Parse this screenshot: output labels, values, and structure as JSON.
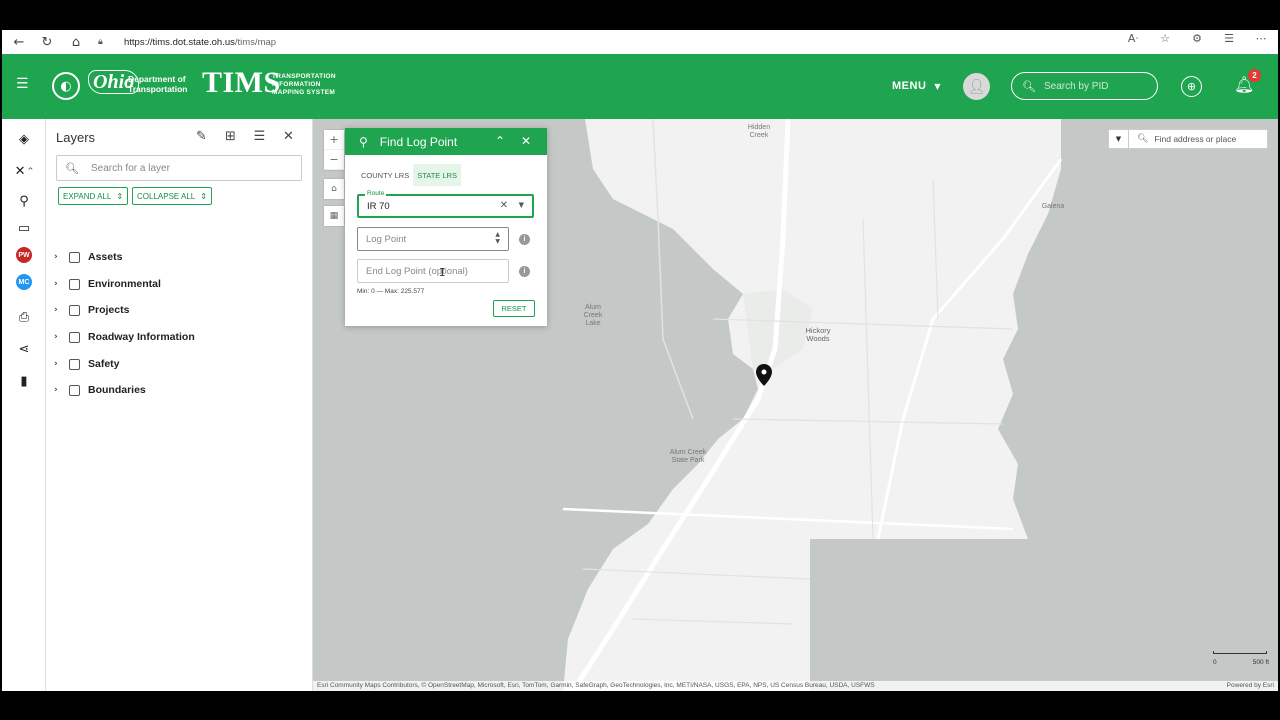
{
  "browser": {
    "url_host": "https://tims.dot.state.oh.us",
    "url_path": "/tims/map"
  },
  "header": {
    "ohio_word": "Ohio",
    "dept_line1": "Department of",
    "dept_line2": "Transportation",
    "app_name": "TIMS",
    "app_sub": "TRANSPORTATION INFORMATION MAPPING SYSTEM",
    "menu_label": "MENU",
    "pid_placeholder": "Search by PID",
    "notification_count": "2"
  },
  "toolbar": {
    "badges": [
      {
        "text": "PW",
        "color": "#c62828"
      },
      {
        "text": "MC",
        "color": "#2196f3"
      }
    ]
  },
  "layers": {
    "title": "Layers",
    "search_placeholder": "Search for a layer",
    "expand_label": "EXPAND ALL",
    "collapse_label": "COLLAPSE ALL",
    "items": [
      "Assets",
      "Environmental",
      "Projects",
      "Roadway Information",
      "Safety",
      "Boundaries"
    ]
  },
  "find_log_point": {
    "title": "Find Log Point",
    "tab_county": "COUNTY LRS",
    "tab_state": "STATE LRS",
    "route_label": "Route",
    "route_value": "IR 70",
    "log_point_placeholder": "Log Point",
    "end_log_point_placeholder": "End Log Point (optional)",
    "min_max": "Min: 0 — Max: 225.577",
    "reset_label": "RESET"
  },
  "map": {
    "address_placeholder": "Find address or place",
    "labels": {
      "hidden_creek": "Hidden Creek",
      "alum_creek_lake": "Alum Creek Lake",
      "hickory_woods": "Hickory Woods",
      "alum_creek_park": "Alum Creek State Park",
      "galena": "Galena"
    },
    "attribution": "Esri Community Maps Contributors, © OpenStreetMap, Microsoft, Esri, TomTom, Garmin, SafeGraph, GeoTechnologies, Inc, METI/NASA, USGS, EPA, NPS, US Census Bureau, USDA, USFWS",
    "powered_by": "Powered by Esri",
    "scale_start": "0",
    "scale_end": "500 ft"
  },
  "colors": {
    "brand_green": "#1fa44f",
    "map_land": "#f2f2f2",
    "map_water": "#c4c8c6"
  }
}
